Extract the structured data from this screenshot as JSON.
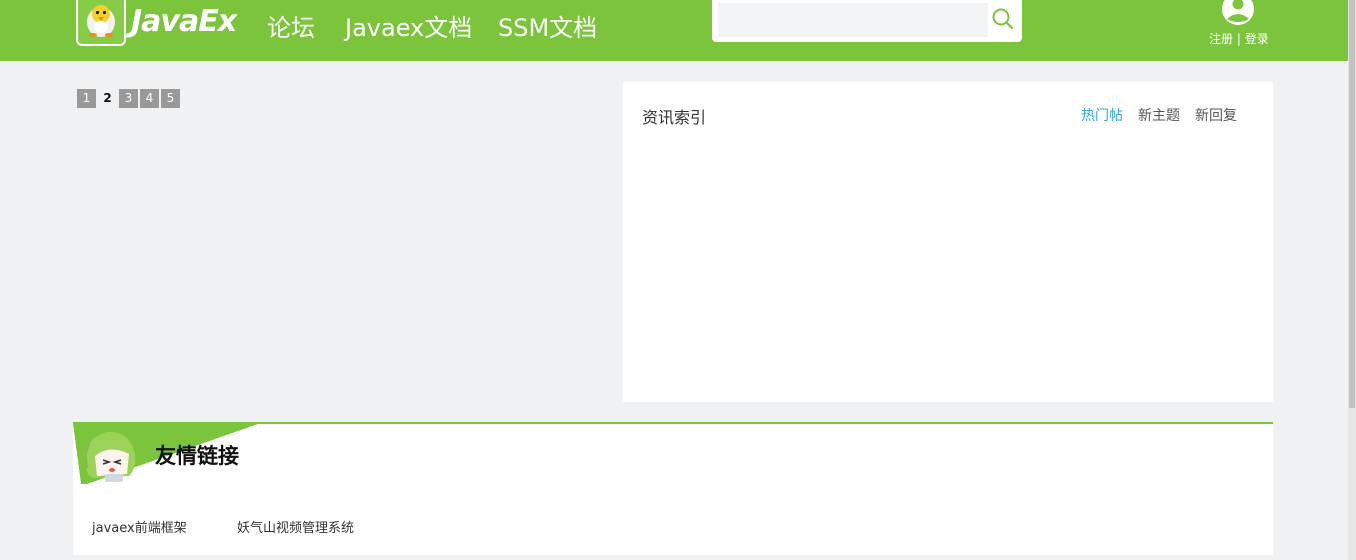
{
  "header": {
    "logo_text": "JavaEx",
    "nav": [
      "论坛",
      "Javaex文档",
      "SSM文档"
    ],
    "search": {
      "value": "",
      "placeholder": ""
    },
    "user": {
      "register": "注册",
      "separator": " | ",
      "login": "登录"
    }
  },
  "pager": {
    "pages": [
      "1",
      "2",
      "3",
      "4",
      "5"
    ],
    "current": "2"
  },
  "news": {
    "title": "资讯索引",
    "tabs": [
      "热门帖",
      "新主题",
      "新回复"
    ],
    "active_tab": "热门帖"
  },
  "friend_links": {
    "title": "友情链接",
    "items": [
      "javaex前端框架",
      "妖气山视频管理系统"
    ]
  },
  "colors": {
    "brand_green": "#7bc43b",
    "active_blue": "#3aa3e0",
    "page_bg": "#f0f1f3"
  },
  "icons": {
    "logo": "chick-logo-icon",
    "search": "search-icon",
    "user": "user-avatar-icon",
    "mascot": "anime-mascot-icon"
  }
}
